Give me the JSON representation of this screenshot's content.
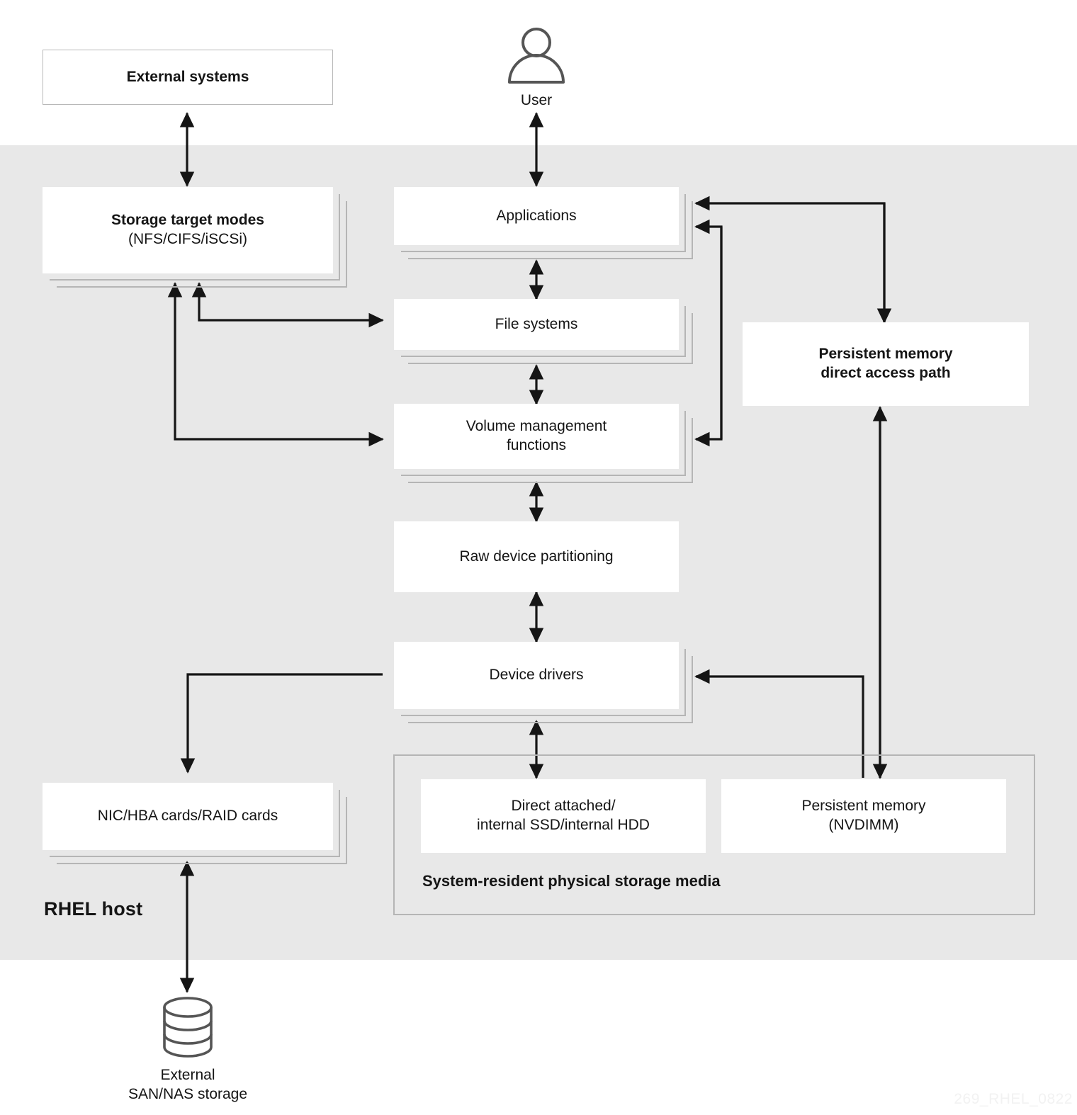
{
  "diagram": {
    "host_band_label": "RHEL host",
    "watermark": "269_RHEL_0822"
  },
  "actors": {
    "user": {
      "label": "User",
      "icon": "user-person-icon"
    },
    "external_storage": {
      "line1": "External",
      "line2": "SAN/NAS storage",
      "icon": "database-cylinder-icon"
    }
  },
  "nodes": {
    "external_systems": {
      "label": "External systems"
    },
    "storage_target_modes": {
      "title": "Storage target modes",
      "subtitle": "(NFS/CIFS/iSCSi)"
    },
    "applications": {
      "label": "Applications"
    },
    "file_systems": {
      "label": "File systems"
    },
    "volume_management": {
      "line1": "Volume management",
      "line2": "functions"
    },
    "raw_device_partitioning": {
      "label": "Raw device partitioning"
    },
    "device_drivers": {
      "label": "Device drivers"
    },
    "persistent_memory_path": {
      "line1": "Persistent memory",
      "line2": "direct access path"
    },
    "nic_hba_raid": {
      "label": "NIC/HBA cards/RAID cards"
    },
    "direct_attached": {
      "line1": "Direct attached/",
      "line2": "internal SSD/internal HDD"
    },
    "persistent_memory": {
      "title": "Persistent memory",
      "subtitle": "(NVDIMM)"
    }
  },
  "groups": {
    "system_resident_media": {
      "label": "System-resident physical storage media"
    }
  },
  "colors": {
    "host_band": "#e8e8e8",
    "node_fill": "#ffffff",
    "node_border": "#b8b8b8",
    "stack_shadow": "#b5b5b5",
    "arrow": "#151515",
    "text": "#151515",
    "watermark": "#f2f2f2"
  }
}
